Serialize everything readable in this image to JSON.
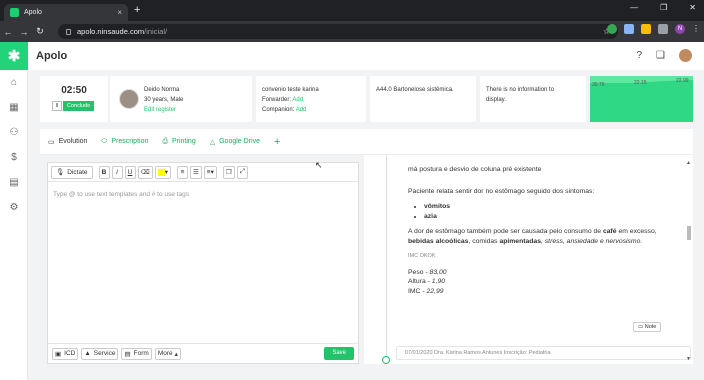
{
  "browser": {
    "tab_title": "Apolo",
    "new_tab": "+",
    "url_host": "apolo.ninsaude.com",
    "url_path": "/inicial/",
    "profile_initial": "N"
  },
  "app": {
    "title": "Apolo"
  },
  "timer": {
    "time": "02:50",
    "pause_label": "II",
    "conclude_label": "Conclude"
  },
  "patient": {
    "name": "Deido Norma",
    "age_sex": "30 years, Male",
    "edit_link": "Edit register"
  },
  "coverage": {
    "line1": "convenio teste karina",
    "forwarder_label": "Forwarder:",
    "forwarder_action": "Add",
    "companion_label": "Companion:",
    "companion_action": "Add"
  },
  "diagnosis": {
    "text": "A44.0 Bartonelose sistêmica."
  },
  "info_card": {
    "text1": "There is no information to",
    "text2": "display."
  },
  "mini_chart": {
    "labels": [
      "30.76",
      "22.15",
      "22.99"
    ]
  },
  "tabs": [
    {
      "label": "Evolution",
      "icon": "chat-icon"
    },
    {
      "label": "Prescription",
      "icon": "pill-icon"
    },
    {
      "label": "Printing",
      "icon": "printer-icon"
    },
    {
      "label": "Google Drive",
      "icon": "drive-icon"
    }
  ],
  "editor": {
    "dictate_label": "Dictate",
    "placeholder": "Type @ to use text templates and # to use tags",
    "footer": {
      "icd": "ICD",
      "service": "Service",
      "form": "Form",
      "more": "More",
      "save": "Save"
    }
  },
  "note": {
    "line1": "má postura e desvio de coluna pré existente",
    "p1": "Paciente relata sentir dor no estômago seguido dos sintomas:",
    "symptoms": [
      "vômitos",
      "azia"
    ],
    "p2a": "A dor de estômago também pode ser causada pelo consumo de ",
    "p2b": "café",
    "p2c": " em excesso, ",
    "p2d": "bebidas alcoólicas",
    "p2e": ", comidas ",
    "p2f": "apimentadas",
    "p2g": ", stress, ansiedade e nervosismo.",
    "imc_label": "IMC OKOK",
    "peso_label": "Peso - ",
    "peso": "83,00",
    "altura_label": "Altura - ",
    "altura": "1,90",
    "imc_row_label": "IMC - ",
    "imc": "22,99",
    "note_button": "Note",
    "next_entry": "07/01/2020 Dra. Karina Ramos Antunes Inscrição: Pediatria"
  }
}
